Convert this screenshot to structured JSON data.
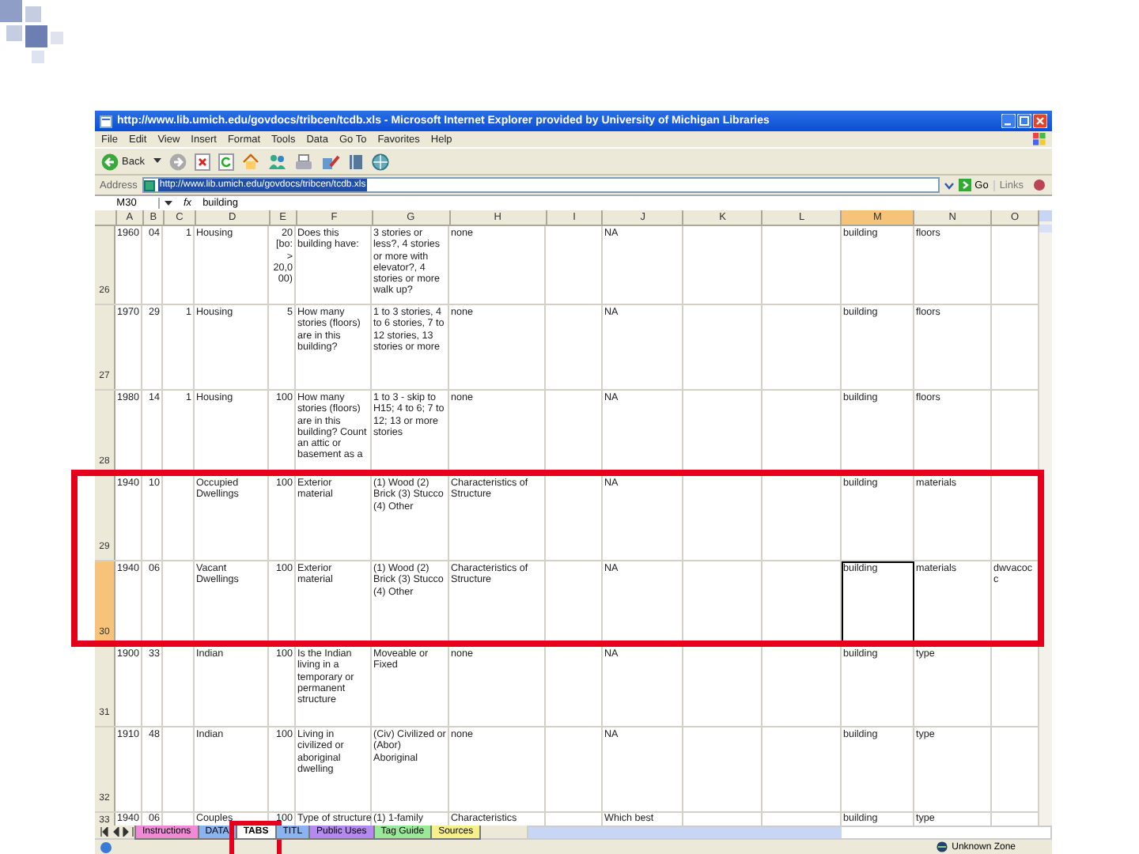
{
  "window": {
    "title": "http://www.lib.umich.edu/govdocs/tribcen/tcdb.xls - Microsoft Internet Explorer provided by University of Michigan Libraries"
  },
  "menu": [
    "File",
    "Edit",
    "View",
    "Insert",
    "Format",
    "Tools",
    "Data",
    "Go To",
    "Favorites",
    "Help"
  ],
  "toolbar": {
    "back_label": "Back"
  },
  "address_bar": {
    "label": "Address",
    "url": "http://www.lib.umich.edu/govdocs/tribcen/tcdb.xls",
    "go": "Go",
    "links": "Links"
  },
  "formula_bar": {
    "cell": "M30",
    "function_label": "fx",
    "value": "building"
  },
  "columns": [
    {
      "label": "A",
      "selected": false
    },
    {
      "label": "B",
      "selected": false
    },
    {
      "label": "C",
      "selected": false
    },
    {
      "label": "D",
      "selected": false
    },
    {
      "label": "E",
      "selected": false
    },
    {
      "label": "F",
      "selected": false
    },
    {
      "label": "G",
      "selected": false
    },
    {
      "label": "H",
      "selected": false
    },
    {
      "label": "I",
      "selected": false
    },
    {
      "label": "J",
      "selected": false
    },
    {
      "label": "K",
      "selected": false
    },
    {
      "label": "L",
      "selected": false
    },
    {
      "label": "M",
      "selected": true
    },
    {
      "label": "N",
      "selected": false
    },
    {
      "label": "O",
      "selected": false
    }
  ],
  "rows": [
    {
      "number": "26",
      "selected": false,
      "highlighted": false,
      "a": "1960",
      "b": "04",
      "c": "1",
      "d": "Housing",
      "e": "20 [bo: > 20,0 00)",
      "f": "Does this building have:",
      "g": "3 stories or less?, 4 stories or more with elevator?, 4 stories or more walk up?",
      "h": "none",
      "j": "NA",
      "m": "building",
      "n": "floors"
    },
    {
      "number": "27",
      "selected": false,
      "highlighted": false,
      "a": "1970",
      "b": "29",
      "c": "1",
      "d": "Housing",
      "e": "5",
      "f": "How many stories (floors) are in this building?",
      "g": "1 to 3 stories, 4 to 6 stories, 7 to 12 stories, 13 stories or more",
      "h": "none",
      "j": "NA",
      "m": "building",
      "n": "floors"
    },
    {
      "number": "28",
      "selected": false,
      "highlighted": false,
      "a": "1980",
      "b": "14",
      "c": "1",
      "d": "Housing",
      "e": "100",
      "f": "How many stories (floors) are in this building? Count an attic or basement as a",
      "g": "1 to 3 - skip to H15; 4 to 6; 7 to 12; 13 or more stories",
      "h": "none",
      "j": "NA",
      "m": "building",
      "n": "floors"
    },
    {
      "number": "29",
      "selected": false,
      "highlighted": true,
      "a": "1940",
      "b": "10",
      "d": "Occupied Dwellings",
      "e": "100",
      "f": "Exterior material",
      "g": "(1) Wood (2) Brick (3) Stucco (4) Other",
      "h": "Characteristics of Structure",
      "j": "NA",
      "m": "building",
      "n": "materials"
    },
    {
      "number": "30",
      "selected": true,
      "highlighted": true,
      "a": "1940",
      "b": "06",
      "d": "Vacant Dwellings",
      "e": "100",
      "f": "Exterior material",
      "g": "(1) Wood (2) Brick (3) Stucco (4) Other",
      "h": "Characteristics of Structure",
      "j": "NA",
      "m": "building",
      "n": "materials",
      "o": "dwvacocc"
    },
    {
      "number": "31",
      "selected": false,
      "highlighted": false,
      "a": "1900",
      "b": "33",
      "d": "Indian",
      "e": "100",
      "f": "Is the Indian living in a temporary or permanent structure",
      "g": "Moveable or Fixed",
      "h": "none",
      "j": "NA",
      "m": "building",
      "n": "type"
    },
    {
      "number": "32",
      "selected": false,
      "highlighted": false,
      "a": "1910",
      "b": "48",
      "d": "Indian",
      "e": "100",
      "f": "Living in civilized or aboriginal dwelling",
      "g": "(Civ) Civilized or (Abor) Aboriginal",
      "h": "none",
      "j": "NA",
      "m": "building",
      "n": "type"
    },
    {
      "number": "33",
      "selected": false,
      "highlighted": false,
      "a": "1940",
      "b": "06",
      "d": "Couples",
      "e": "100",
      "f": "Type of structure",
      "g": "(1) 1-family",
      "h": "Characteristics",
      "j": "Which best",
      "m": "building",
      "n": "type"
    }
  ],
  "sheet_tabs": [
    {
      "label": "Instructions",
      "selected": false,
      "highlighted": false,
      "color": "#f08ad8"
    },
    {
      "label": "DATA",
      "selected": false,
      "highlighted": false,
      "color": "#8ab4f0"
    },
    {
      "label": "TABS",
      "selected": true,
      "highlighted": true,
      "color": "#ffffff"
    },
    {
      "label": "TITL",
      "selected": false,
      "highlighted": false,
      "color": "#8ab4f0"
    },
    {
      "label": "Public Uses",
      "selected": false,
      "highlighted": false,
      "color": "#b48af0"
    },
    {
      "label": "Tag Guide",
      "selected": false,
      "highlighted": false,
      "color": "#9ae89a"
    },
    {
      "label": "Sources",
      "selected": false,
      "highlighted": false,
      "color": "#f5f08a"
    }
  ],
  "status_bar": {
    "zone": "Unknown Zone"
  }
}
